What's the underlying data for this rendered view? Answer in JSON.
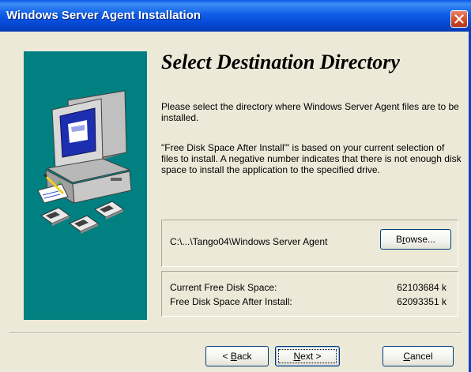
{
  "window": {
    "title": "Windows Server Agent Installation"
  },
  "page": {
    "heading": "Select Destination Directory",
    "intro": "Please select the directory where Windows Server Agent files are to be installed.",
    "explanation": "\"Free Disk Space After Install\"' is based on your current selection of files to install.  A negative number indicates that there is not enough disk space to install the application to the specified drive."
  },
  "destination": {
    "path": "C:\\...\\Tango04\\Windows Server Agent",
    "browse_label": "Browse...",
    "browse_hotkey": "r"
  },
  "disk_space": {
    "current_label": "Current Free Disk Space:",
    "current_value": "62103684 k",
    "after_label": "Free Disk Space After Install:",
    "after_value": "62093351 k"
  },
  "buttons": {
    "back_prefix": "< ",
    "back_hotkey": "B",
    "back_rest": "ack",
    "next_hotkey": "N",
    "next_rest": "ext >",
    "cancel_hotkey": "C",
    "cancel_rest": "ancel"
  },
  "colors": {
    "titlebar": "#0a58e6",
    "dialog_background": "#ece9d8",
    "side_panel": "#008080",
    "close_button": "#d6502a"
  },
  "icons": {
    "close": "close-icon",
    "side_art": "computer-with-floppy-disks-illustration"
  }
}
